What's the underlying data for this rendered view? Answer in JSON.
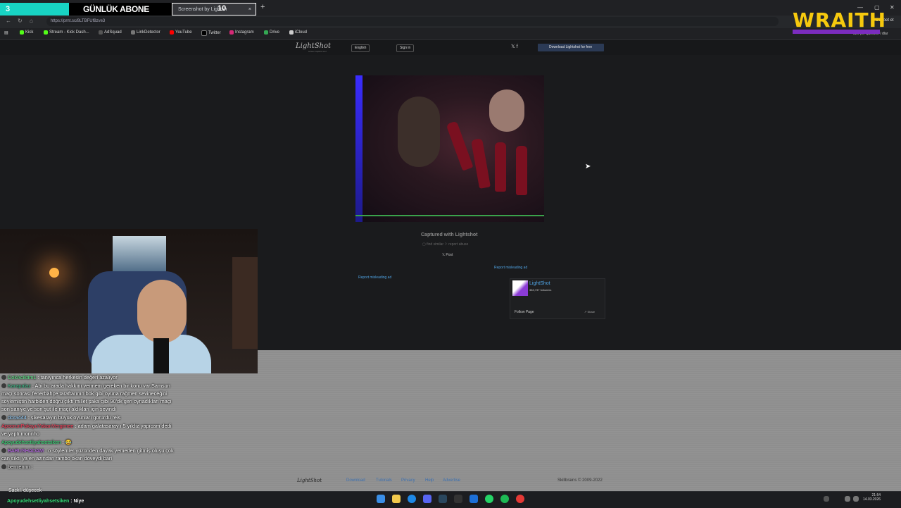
{
  "browser": {
    "overlay_tab": "3",
    "abone_tab": "GÜNLÜK ABONE",
    "active_tab_title": "Screenshot by Lightsh",
    "tab_count": "10",
    "tab_close": "×",
    "new_tab": "+",
    "url": "https://prnt.sc/8LTBFUf8zve3",
    "bookmarks": [
      "Kick",
      "Stream - Kick Dash...",
      "AdSquad",
      "LinkDetector",
      "YouTube",
      "Twitter",
      "Instagram",
      "Drive",
      "iCloud"
    ],
    "side_label": "tüm yer işaretleri / dlar",
    "sohbet": "Sohbet et"
  },
  "overlay": {
    "wraith": "WRAITH"
  },
  "lightshot": {
    "logo": "LightShot",
    "logo_sub": "screen capture tool",
    "language": "English",
    "signin": "Sign in",
    "social": "𝕏  f",
    "download": "Download Lightshot for free",
    "captured": "Captured with Lightshot",
    "links": "▢ find similar   ⚐ report abuse",
    "xpost": "𝕏 Post",
    "report_right": "Report misleading ad",
    "report_left": "Report misleading ad",
    "fb_name": "LightShot",
    "fb_followers": "383,737 followers",
    "fb_follow": "Follow Page",
    "fb_share": "↗ Share",
    "footer_logo": "LightShot",
    "footer_links": [
      "Download",
      "Tutorials",
      "Privacy",
      "Help",
      "Advertise"
    ],
    "footer_copy": "Skillbrains © 2009-2022"
  },
  "chat": [
    {
      "user": "CokAciktim1",
      "text": ": tanıyınca herkesin değeri azalıyor",
      "cls": "u1"
    },
    {
      "user": "Karapalaz",
      "text": ": Abi bu arada hakkını vermem gereken bir konu var.Samsun maçı sonrası fenerbahçe taraftarının bok gibi oyuna rağmen sevineceğini söylemiştin harbiden doğru çıktı millet şaka gibi 90'dk geri oynadıkları maçı son saniye ve son şut ile maçı aldıkları için sevindi",
      "cls": "u2"
    },
    {
      "user": "dora444",
      "text": ": şikesarayın büyük oyunları görürdü reis",
      "cls": "u3"
    },
    {
      "user": "ApoorunPoksyuYakanVergimee",
      "text": ": adam galatasaray ı 5 yıldız yapıcam dedi ve yaptı morinho",
      "cls": "u4"
    },
    {
      "user": "Apoyudehsetliyahsetsiken",
      "text": ": 😂",
      "cls": "u5"
    },
    {
      "user": "BABUSHADAM",
      "text": ": o söylemler yüzünden dayak yemeden gitmiş oluşu çok can sıktı ya en azından rambo okan döveydi bari",
      "cls": "u6"
    },
    {
      "user": "berrrennn",
      "text": ":",
      "cls": "u7"
    }
  ],
  "alert": {
    "small": "Sackl. düşecek",
    "user": "Apoyudehsetliyahsetsiken",
    "message": ": Niye"
  },
  "taskbar": {
    "time": "21:54",
    "date": "14.03.2026"
  }
}
